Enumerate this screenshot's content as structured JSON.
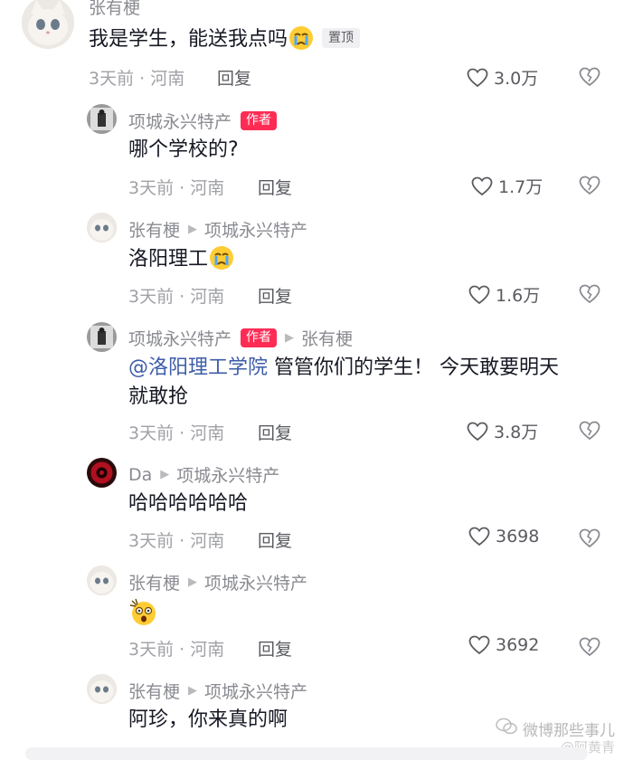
{
  "comments": [
    {
      "user": "张有梗",
      "text": "我是学生，能送我点吗",
      "pin_badge": "置顶",
      "time": "3天前",
      "location": "河南",
      "reply_label": "回复",
      "likes": "3.0万"
    },
    {
      "user": "项城永兴特产",
      "author_badge": "作者",
      "text": "哪个学校的?",
      "time": "3天前",
      "location": "河南",
      "reply_label": "回复",
      "likes": "1.7万"
    },
    {
      "user": "张有梗",
      "reply_to": "项城永兴特产",
      "text": "洛阳理工",
      "time": "3天前",
      "location": "河南",
      "reply_label": "回复",
      "likes": "1.6万"
    },
    {
      "user": "项城永兴特产",
      "author_badge": "作者",
      "reply_to": "张有梗",
      "mention": "@洛阳理工学院",
      "text_line1": " 管管你们的学生！ 今天敢要明天",
      "text_line2": "就敢抢",
      "time": "3天前",
      "location": "河南",
      "reply_label": "回复",
      "likes": "3.8万"
    },
    {
      "user": "Da",
      "reply_to": "项城永兴特产",
      "text": "哈哈哈哈哈哈",
      "time": "3天前",
      "location": "河南",
      "reply_label": "回复",
      "likes": "3698"
    },
    {
      "user": "张有梗",
      "reply_to": "项城永兴特产",
      "text": "",
      "time": "3天前",
      "location": "河南",
      "reply_label": "回复",
      "likes": "3692"
    },
    {
      "user": "张有梗",
      "reply_to": "项城永兴特产",
      "text": "阿珍，你来真的啊"
    }
  ],
  "meta_separator": " · ",
  "watermark": {
    "text": "微博那些事儿",
    "sub": "@阿黄青"
  },
  "icons": {
    "like": "heart-outline-icon",
    "dislike": "broken-heart-icon",
    "arrow": "right-triangle-icon"
  },
  "colors": {
    "author_badge": "#fe2c55",
    "mention": "#3d5da8",
    "meta": "#a0a1a6"
  }
}
